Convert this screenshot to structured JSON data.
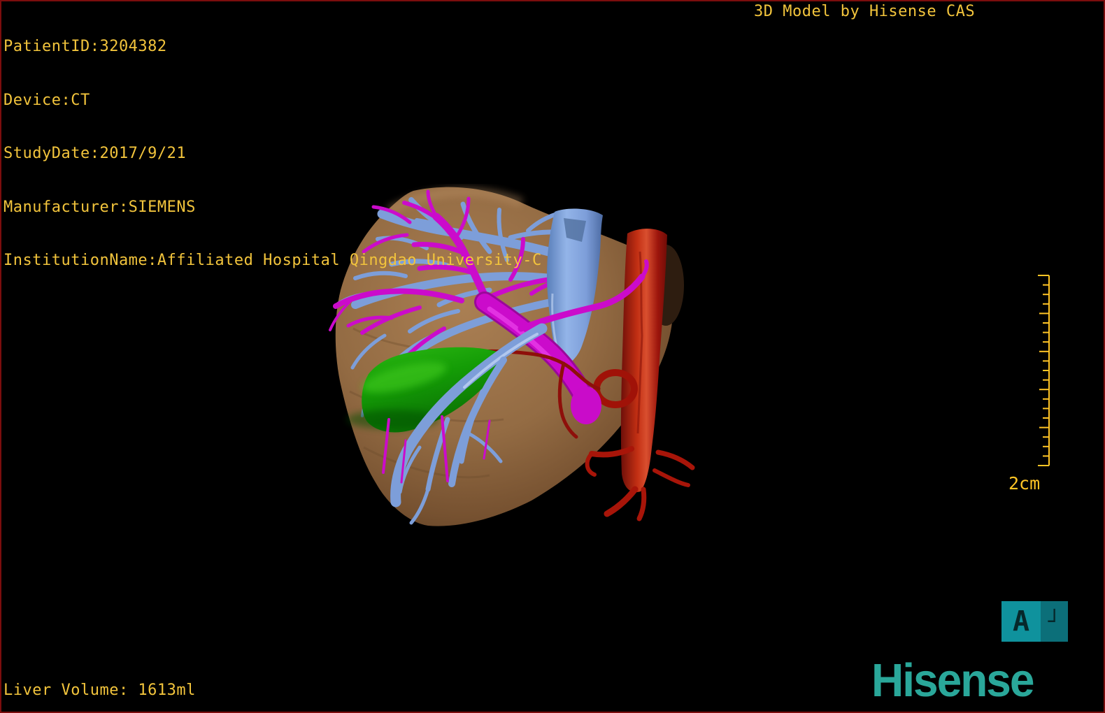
{
  "overlay": {
    "text_color": "#f2c43c",
    "patient_lines": [
      "PatientID:3204382",
      "Device:CT",
      "StudyDate:2017/9/21",
      "Manufacturer:SIEMENS",
      "InstitutionName:Affiliated Hospital Qingdao University-C"
    ],
    "title": "3D Model by Hisense CAS",
    "liver_volume": "Liver Volume: 1613ml"
  },
  "scale_ruler": {
    "label": "2cm",
    "color": "#ffc425"
  },
  "orientation_marker": {
    "letter": "A",
    "corner_glyph": "┘",
    "front_color": "#0f929d",
    "side_color": "#0c6f79"
  },
  "logo": {
    "text": "Hisense",
    "color": "#2aa79a"
  },
  "scene": {
    "description": "3D liver model with vasculature",
    "colors": {
      "liver": "#8f6a45",
      "portal_vein": "#7d9ed9",
      "vena_cava": "#8fb0e2",
      "bile_duct": "#cb0bcb",
      "artery": "#b5170e",
      "artery_branch": "#8e0f0a",
      "gallbladder": "#17a008"
    }
  }
}
